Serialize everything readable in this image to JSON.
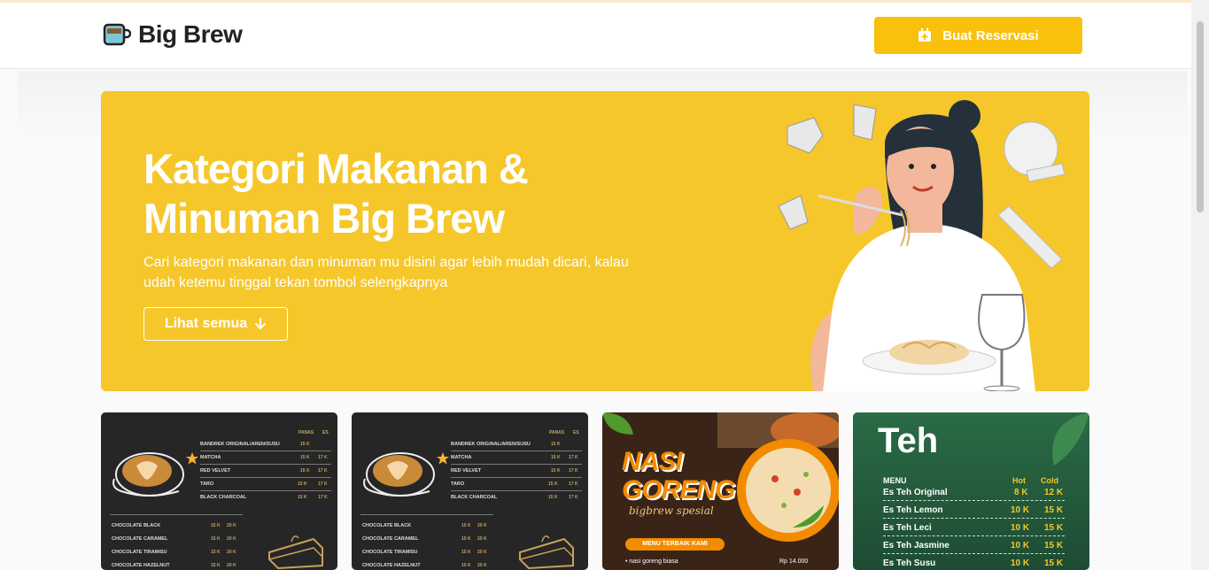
{
  "navbar": {
    "brand": "Big Brew",
    "cta_label": "Buat Reservasi"
  },
  "hero": {
    "title_line1": "Kategori Makanan &",
    "title_line2": "Minuman Big Brew",
    "description_line1": "Cari kategori makanan dan minuman mu disini agar lebih mudah dicari, kalau",
    "description_line2": "udah ketemu tinggal tekan tombol selengkapnya",
    "button_label": "Lihat semua"
  },
  "colors": {
    "accent": "#f9c10c",
    "hero_bg": "#f6c72b"
  },
  "cards": {
    "menu_dark": {
      "col_headers": [
        "PANAS",
        "ES"
      ],
      "items_top": [
        {
          "name": "BANDREK ORIGINAL/AREN/SUSU",
          "hot": "15 K",
          "cold": ""
        },
        {
          "name": "MATCHA",
          "hot": "15 K",
          "cold": "17 K"
        },
        {
          "name": "RED VELVET",
          "hot": "15 K",
          "cold": "17 K"
        },
        {
          "name": "TARO",
          "hot": "15 K",
          "cold": "17 K"
        },
        {
          "name": "BLACK CHARCOAL",
          "hot": "15 K",
          "cold": "17 K"
        }
      ],
      "items_bottom": [
        {
          "name": "CHOCOLATE BLACK",
          "hot": "15 K",
          "cold": "20 K"
        },
        {
          "name": "CHOCOLATE CARAMEL",
          "hot": "15 K",
          "cold": "20 K"
        },
        {
          "name": "CHOCOLATE TIRAMISU",
          "hot": "15 K",
          "cold": "20 K"
        },
        {
          "name": "CHOCOLATE HAZELNUT",
          "hot": "15 K",
          "cold": "20 K"
        }
      ]
    },
    "nasi": {
      "title_line1": "NASI",
      "title_line2": "GORENG",
      "subtitle": "bigbrew spesial",
      "badge": "MENU TERBAIK KAMI",
      "item": "• nasi goreng biasa",
      "price": "Rp 14.000"
    },
    "teh": {
      "title": "Teh",
      "menu_label": "MENU",
      "hot_label": "Hot",
      "cold_label": "Cold",
      "items": [
        {
          "name": "Es Teh Original",
          "hot": "8 K",
          "cold": "12 K"
        },
        {
          "name": "Es Teh Lemon",
          "hot": "10 K",
          "cold": "15 K"
        },
        {
          "name": "Es Teh Leci",
          "hot": "10 K",
          "cold": "15 K"
        },
        {
          "name": "Es Teh Jasmine",
          "hot": "10 K",
          "cold": "15 K"
        },
        {
          "name": "Es Teh Susu",
          "hot": "10 K",
          "cold": "15 K"
        }
      ]
    }
  }
}
